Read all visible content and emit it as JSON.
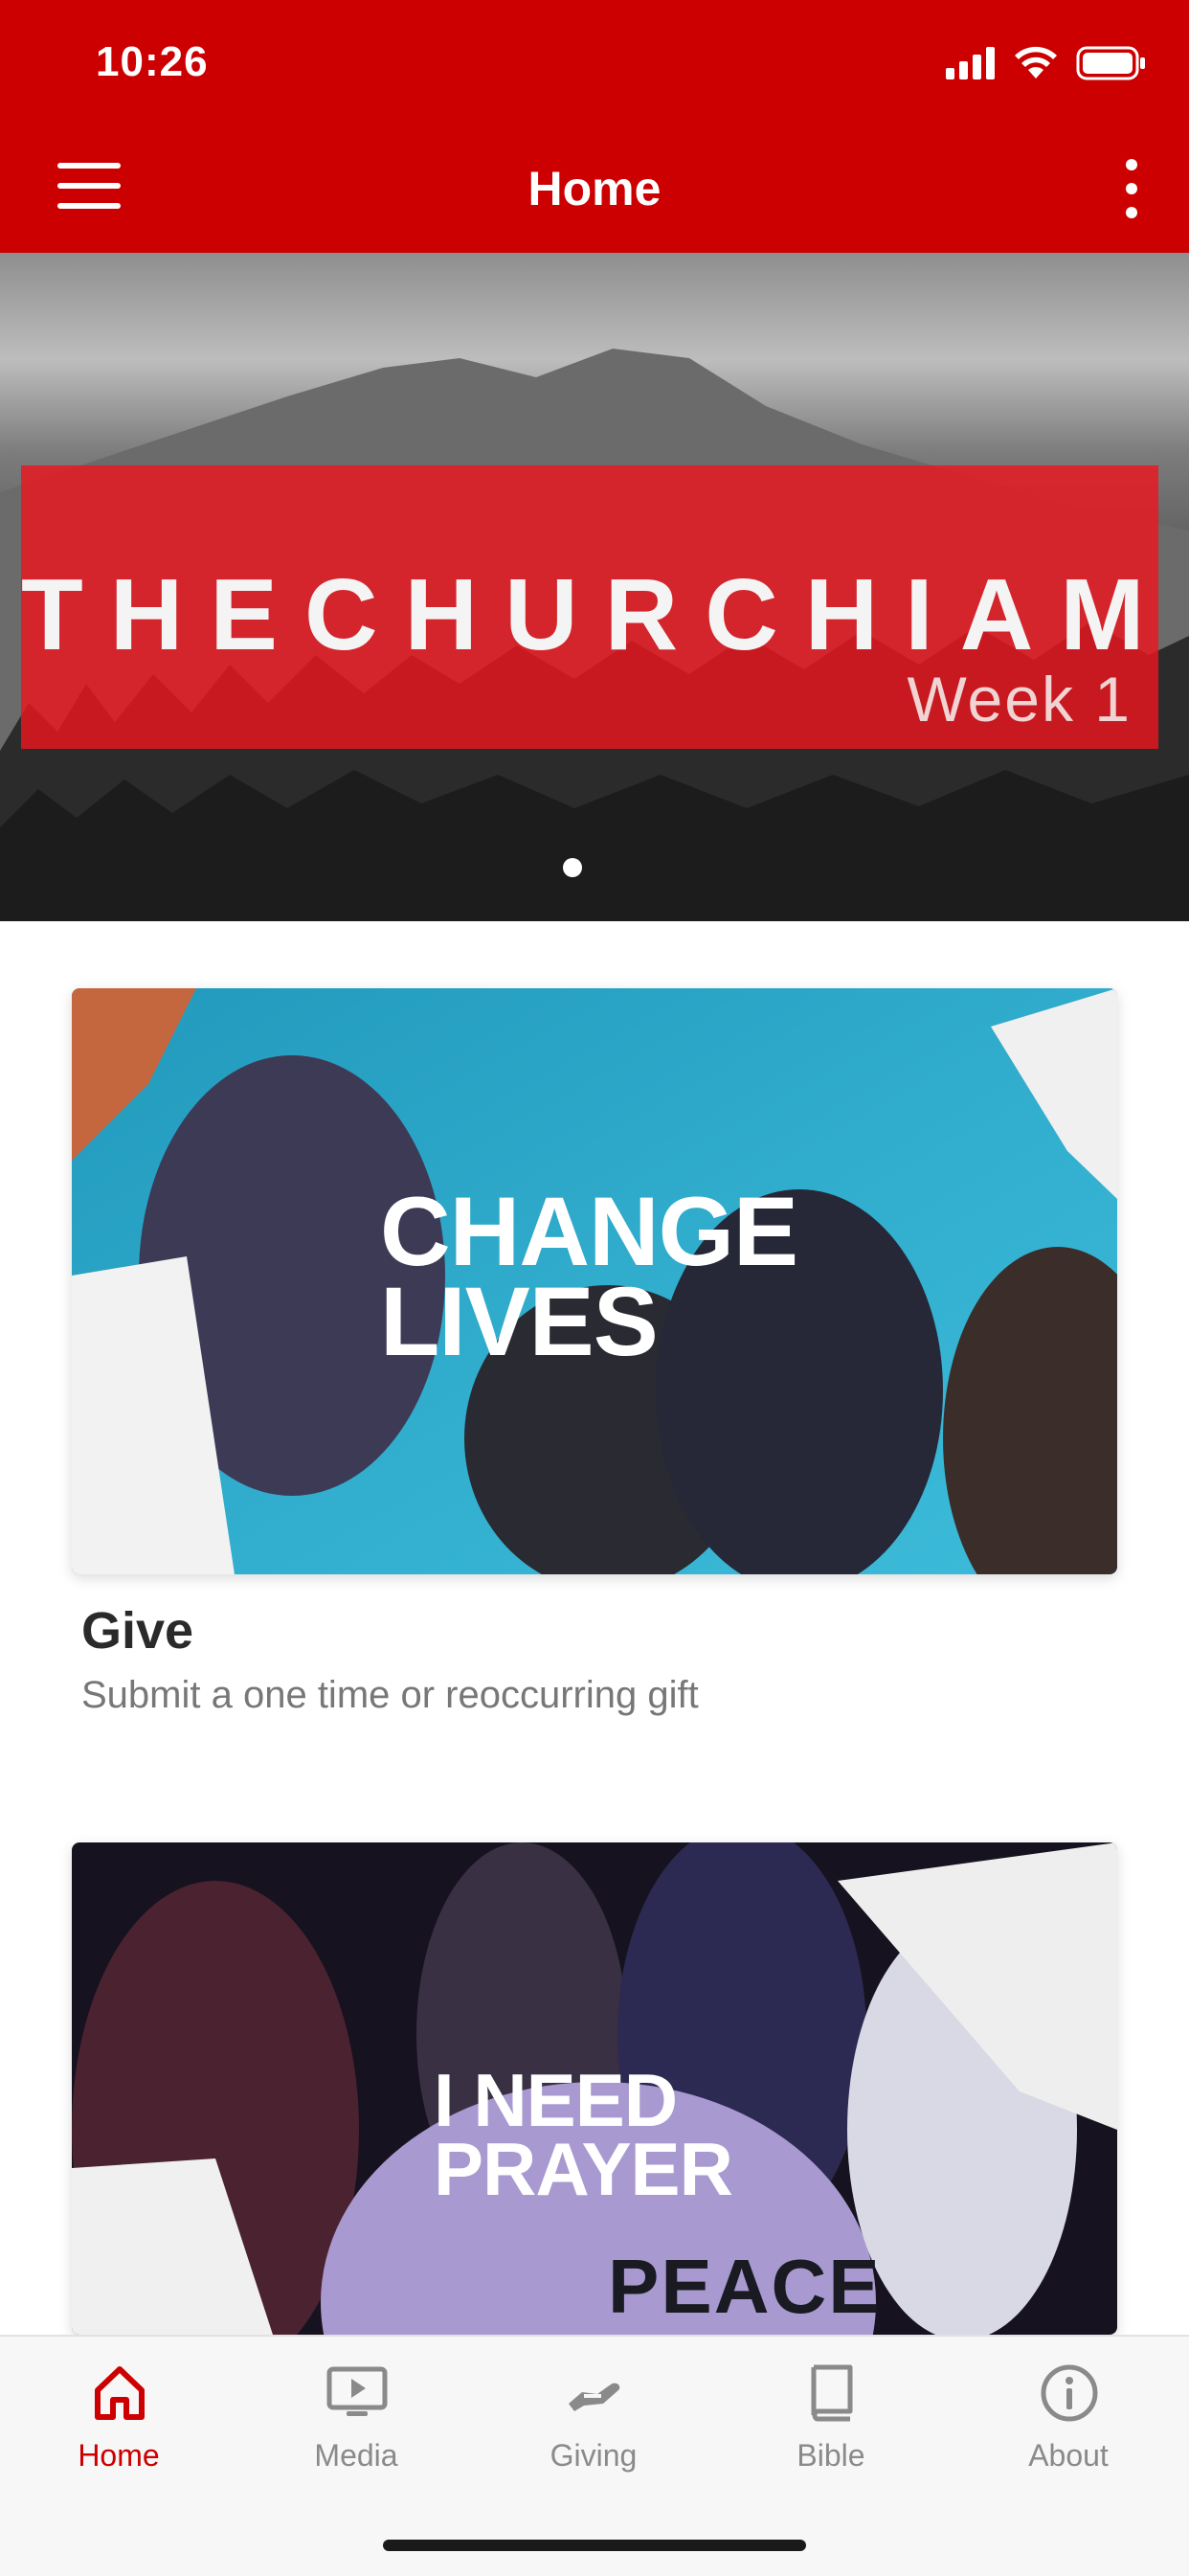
{
  "status_bar": {
    "time": "10:26"
  },
  "header": {
    "title": "Home"
  },
  "hero": {
    "title": "THECHURCHIAM",
    "subtitle": "Week 1"
  },
  "cards": [
    {
      "overlay_line1": "CHANGE",
      "overlay_line2": "LIVES",
      "title": "Give",
      "subtitle": "Submit a one time or reoccurring gift"
    },
    {
      "overlay_line1": "I NEED",
      "overlay_line2": "PRAYER",
      "overlay_detail": "PEACE"
    }
  ],
  "tabs": [
    {
      "label": "Home",
      "icon": "home-icon",
      "active": true
    },
    {
      "label": "Media",
      "icon": "play-screen-icon"
    },
    {
      "label": "Giving",
      "icon": "giving-hand-icon"
    },
    {
      "label": "Bible",
      "icon": "book-icon"
    },
    {
      "label": "About",
      "icon": "info-icon"
    }
  ],
  "colors": {
    "brand": "#cc0000",
    "tab_active": "#cc0000",
    "tab_inactive": "#8a8a8a"
  }
}
